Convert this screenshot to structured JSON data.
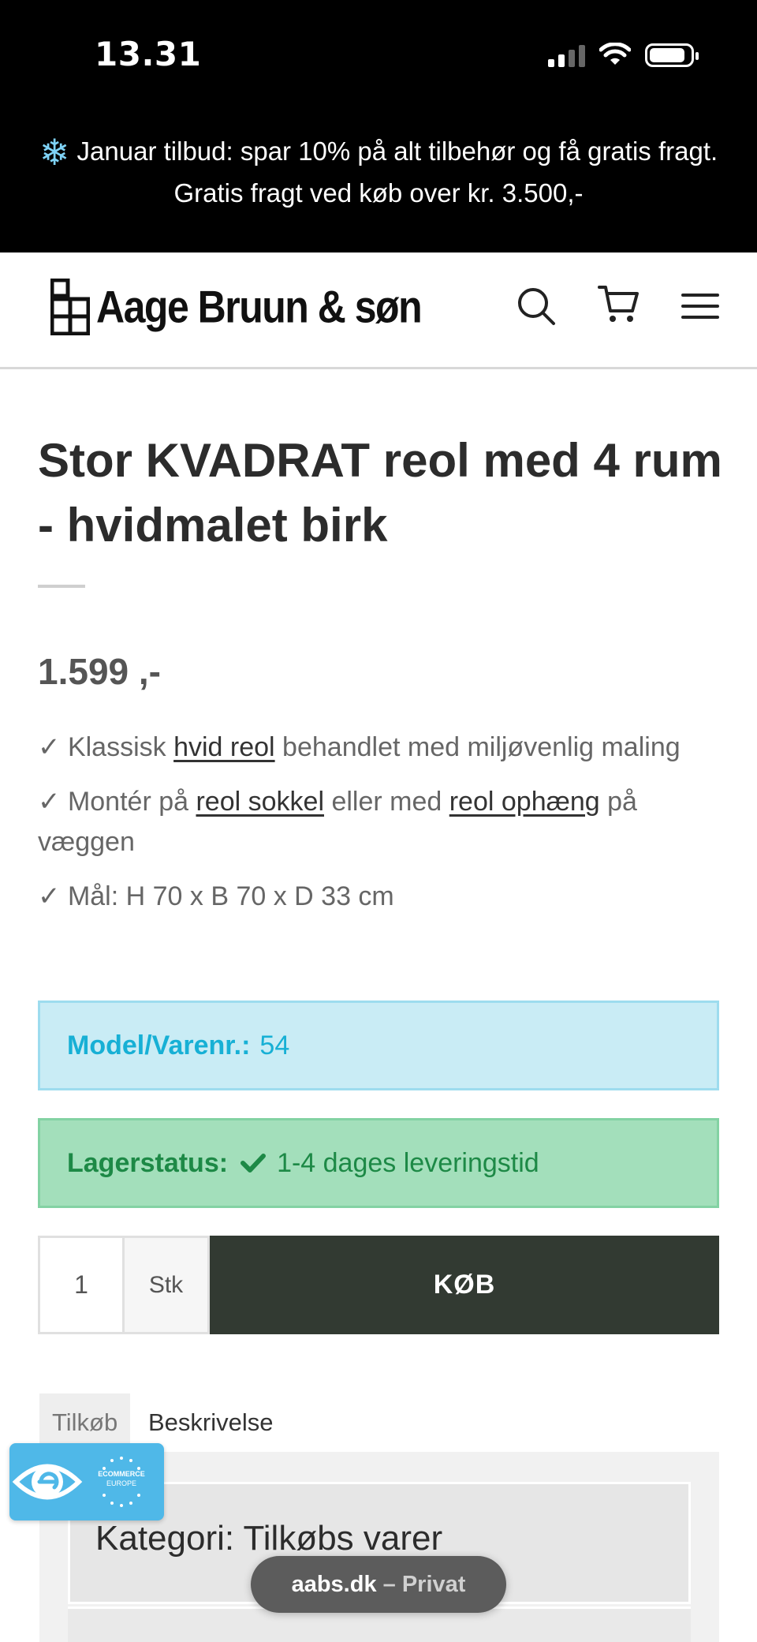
{
  "status_bar": {
    "time": "13.31",
    "icons": [
      "cellular-signal-icon",
      "wifi-icon",
      "battery-icon"
    ]
  },
  "promo_banner": {
    "icon": "snowflake-icon",
    "text": "Januar tilbud: spar 10% på alt tilbehør og få gratis fragt. Gratis fragt ved køb over kr. 3.500,-"
  },
  "header": {
    "logo_text": "Aage Bruun & søn",
    "icons": [
      "search-icon",
      "cart-icon",
      "menu-icon"
    ]
  },
  "product": {
    "title": "Stor KVADRAT reol med 4 rum - hvidmalet birk",
    "price": "1.599 ,-",
    "features": {
      "f1_check": "✓",
      "f1_pre": " Klassisk ",
      "f1_link": "hvid reol",
      "f1_post": " behandlet med miljøvenlig maling",
      "f2_check": "✓",
      "f2_pre": " Montér på ",
      "f2_link1": "reol sokkel",
      "f2_mid": " eller med ",
      "f2_link2": "reol ophæng",
      "f2_post": " på væggen",
      "f3_check": "✓",
      "f3_text": " Mål: H 70 x B 70 x D 33 cm"
    },
    "model_label": "Model/Varenr.:",
    "model_value": "54",
    "stock_label": "Lagerstatus:",
    "stock_value": "1-4 dages leveringstid",
    "quantity": "1",
    "unit": "Stk",
    "buy_label": "KØB"
  },
  "tabs": {
    "tilkob": "Tilkøb",
    "beskrivelse": "Beskrivelse"
  },
  "panel": {
    "heading": "Kategori: Tilkøbs varer"
  },
  "trust_badge": {
    "icon": "e-mark-icon",
    "seal_text": "ECOMMERCE EUROPE"
  },
  "browser": {
    "domain": "aabs.dk",
    "mode": " – Privat"
  },
  "colors": {
    "buy_button": "#323a32",
    "model_box_text": "#17b0d5",
    "stock_box_text": "#1d8946",
    "trust_badge": "#4fb8e8"
  }
}
